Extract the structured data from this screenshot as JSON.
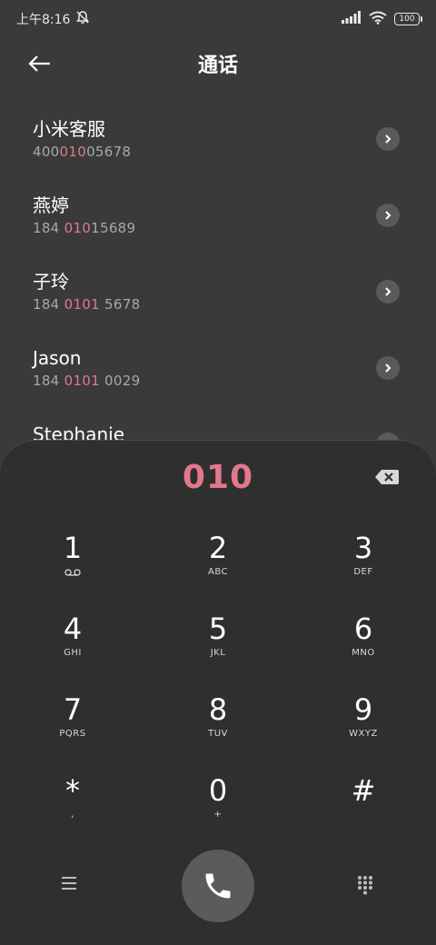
{
  "status_bar": {
    "time": "上午8:16",
    "battery": "100"
  },
  "header": {
    "title": "通话"
  },
  "contacts": [
    {
      "name": "小米客服",
      "number_pre": "400",
      "number_hl": "010",
      "number_post": "05678"
    },
    {
      "name": "燕婷",
      "number_pre": "184 ",
      "number_hl": "010",
      "number_post": "15689"
    },
    {
      "name": "子玲",
      "number_pre": "184 ",
      "number_hl": "0101",
      "number_post": " 5678"
    },
    {
      "name": "Jason",
      "number_pre": "184 ",
      "number_hl": "0101",
      "number_post": " 0029"
    },
    {
      "name": "Stephanie",
      "number_pre": "",
      "number_hl": "",
      "number_post": ""
    }
  ],
  "dialpad": {
    "entered_number": "010",
    "keys": [
      {
        "digit": "1",
        "letters": ""
      },
      {
        "digit": "2",
        "letters": "ABC"
      },
      {
        "digit": "3",
        "letters": "DEF"
      },
      {
        "digit": "4",
        "letters": "GHI"
      },
      {
        "digit": "5",
        "letters": "JKL"
      },
      {
        "digit": "6",
        "letters": "MNO"
      },
      {
        "digit": "7",
        "letters": "PQRS"
      },
      {
        "digit": "8",
        "letters": "TUV"
      },
      {
        "digit": "9",
        "letters": "WXYZ"
      },
      {
        "digit": "*",
        "letters": ","
      },
      {
        "digit": "0",
        "letters": "+"
      },
      {
        "digit": "#",
        "letters": ""
      }
    ]
  },
  "colors": {
    "accent": "#e2788c",
    "background": "#3a3a3a",
    "panel": "#2f2f2f"
  }
}
